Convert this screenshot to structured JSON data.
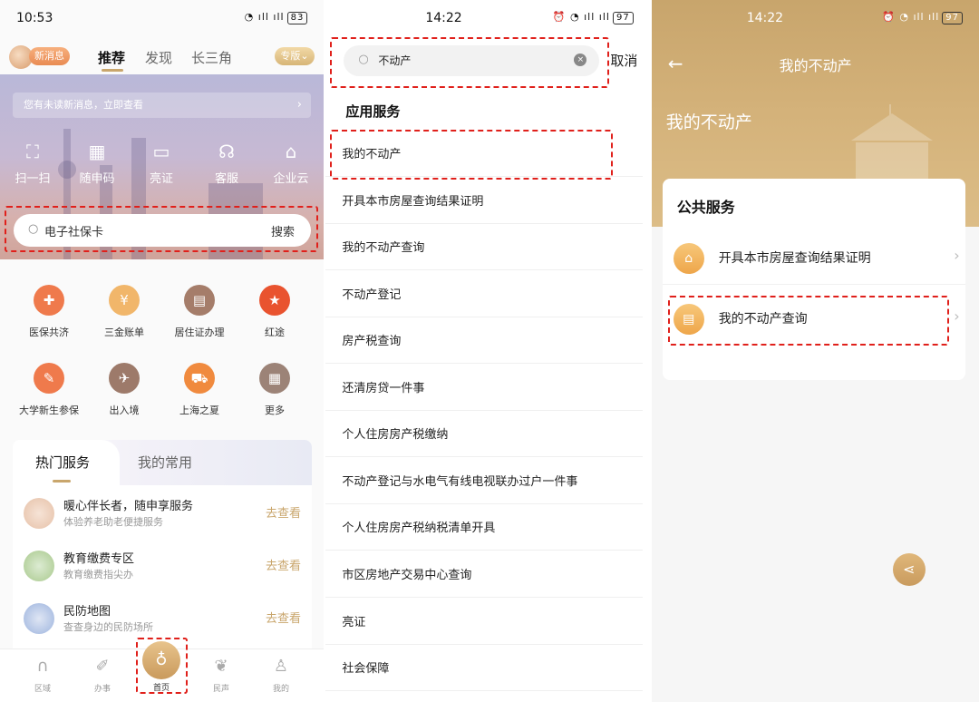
{
  "colors": {
    "accent": "#c9a66c",
    "highlight": "#e0201b"
  },
  "home": {
    "time": "10:53",
    "battery": "83",
    "new_msg": "新消息",
    "tabs": [
      "推荐",
      "发现",
      "长三角"
    ],
    "edition": "专版",
    "notice": "您有未读新消息，立即查看",
    "quick_actions": [
      "扫一扫",
      "随申码",
      "亮证",
      "客服",
      "企业云"
    ],
    "search_placeholder": "电子社保卡",
    "search_button": "搜索",
    "grid": [
      "医保共济",
      "三金账单",
      "居住证办理",
      "红途",
      "大学新生参保",
      "出入境",
      "上海之夏",
      "更多"
    ],
    "service_tabs": [
      "热门服务",
      "我的常用"
    ],
    "services": [
      {
        "title": "暖心伴长者，随申享服务",
        "subtitle": "体验养老助老便捷服务",
        "action": "去查看"
      },
      {
        "title": "教育缴费专区",
        "subtitle": "教育缴费指尖办",
        "action": "去查看"
      },
      {
        "title": "民防地图",
        "subtitle": "查查身边的民防场所",
        "action": "去查看"
      }
    ],
    "bottom_nav": [
      "区域",
      "办事",
      "首页",
      "民声",
      "我的"
    ]
  },
  "search": {
    "time": "14:22",
    "battery": "97",
    "query": "不动产",
    "cancel": "取消",
    "section": "应用服务",
    "results": [
      "我的不动产",
      "开具本市房屋查询结果证明",
      "我的不动产查询",
      "不动产登记",
      "房产税查询",
      "还清房贷一件事",
      "个人住房房产税缴纳",
      "不动产登记与水电气有线电视联办过户一件事",
      "个人住房房产税纳税清单开具",
      "市区房地产交易中心查询",
      "亮证",
      "社会保障"
    ]
  },
  "detail": {
    "time": "14:22",
    "battery": "97",
    "title": "我的不动产",
    "banner": "我的不动产",
    "card_title": "公共服务",
    "items": [
      "开具本市房屋查询结果证明",
      "我的不动产查询"
    ]
  }
}
